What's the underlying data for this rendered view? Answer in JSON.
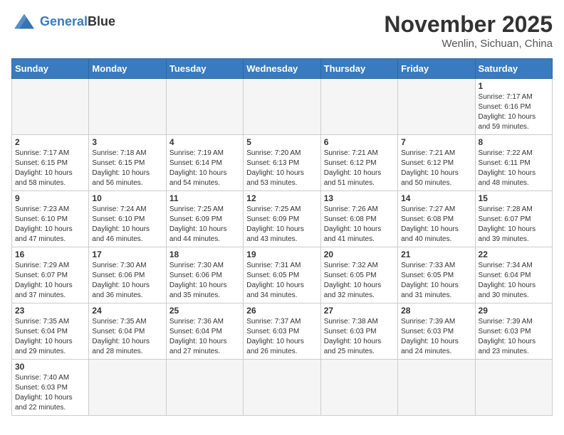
{
  "header": {
    "logo_general": "General",
    "logo_blue": "Blue",
    "month_title": "November 2025",
    "location": "Wenlin, Sichuan, China"
  },
  "weekdays": [
    "Sunday",
    "Monday",
    "Tuesday",
    "Wednesday",
    "Thursday",
    "Friday",
    "Saturday"
  ],
  "weeks": [
    [
      {
        "day": "",
        "info": ""
      },
      {
        "day": "",
        "info": ""
      },
      {
        "day": "",
        "info": ""
      },
      {
        "day": "",
        "info": ""
      },
      {
        "day": "",
        "info": ""
      },
      {
        "day": "",
        "info": ""
      },
      {
        "day": "1",
        "info": "Sunrise: 7:17 AM\nSunset: 6:16 PM\nDaylight: 10 hours and 59 minutes."
      }
    ],
    [
      {
        "day": "2",
        "info": "Sunrise: 7:17 AM\nSunset: 6:15 PM\nDaylight: 10 hours and 58 minutes."
      },
      {
        "day": "3",
        "info": "Sunrise: 7:18 AM\nSunset: 6:15 PM\nDaylight: 10 hours and 56 minutes."
      },
      {
        "day": "4",
        "info": "Sunrise: 7:19 AM\nSunset: 6:14 PM\nDaylight: 10 hours and 54 minutes."
      },
      {
        "day": "5",
        "info": "Sunrise: 7:20 AM\nSunset: 6:13 PM\nDaylight: 10 hours and 53 minutes."
      },
      {
        "day": "6",
        "info": "Sunrise: 7:21 AM\nSunset: 6:12 PM\nDaylight: 10 hours and 51 minutes."
      },
      {
        "day": "7",
        "info": "Sunrise: 7:21 AM\nSunset: 6:12 PM\nDaylight: 10 hours and 50 minutes."
      },
      {
        "day": "8",
        "info": "Sunrise: 7:22 AM\nSunset: 6:11 PM\nDaylight: 10 hours and 48 minutes."
      }
    ],
    [
      {
        "day": "9",
        "info": "Sunrise: 7:23 AM\nSunset: 6:10 PM\nDaylight: 10 hours and 47 minutes."
      },
      {
        "day": "10",
        "info": "Sunrise: 7:24 AM\nSunset: 6:10 PM\nDaylight: 10 hours and 46 minutes."
      },
      {
        "day": "11",
        "info": "Sunrise: 7:25 AM\nSunset: 6:09 PM\nDaylight: 10 hours and 44 minutes."
      },
      {
        "day": "12",
        "info": "Sunrise: 7:25 AM\nSunset: 6:09 PM\nDaylight: 10 hours and 43 minutes."
      },
      {
        "day": "13",
        "info": "Sunrise: 7:26 AM\nSunset: 6:08 PM\nDaylight: 10 hours and 41 minutes."
      },
      {
        "day": "14",
        "info": "Sunrise: 7:27 AM\nSunset: 6:08 PM\nDaylight: 10 hours and 40 minutes."
      },
      {
        "day": "15",
        "info": "Sunrise: 7:28 AM\nSunset: 6:07 PM\nDaylight: 10 hours and 39 minutes."
      }
    ],
    [
      {
        "day": "16",
        "info": "Sunrise: 7:29 AM\nSunset: 6:07 PM\nDaylight: 10 hours and 37 minutes."
      },
      {
        "day": "17",
        "info": "Sunrise: 7:30 AM\nSunset: 6:06 PM\nDaylight: 10 hours and 36 minutes."
      },
      {
        "day": "18",
        "info": "Sunrise: 7:30 AM\nSunset: 6:06 PM\nDaylight: 10 hours and 35 minutes."
      },
      {
        "day": "19",
        "info": "Sunrise: 7:31 AM\nSunset: 6:05 PM\nDaylight: 10 hours and 34 minutes."
      },
      {
        "day": "20",
        "info": "Sunrise: 7:32 AM\nSunset: 6:05 PM\nDaylight: 10 hours and 32 minutes."
      },
      {
        "day": "21",
        "info": "Sunrise: 7:33 AM\nSunset: 6:05 PM\nDaylight: 10 hours and 31 minutes."
      },
      {
        "day": "22",
        "info": "Sunrise: 7:34 AM\nSunset: 6:04 PM\nDaylight: 10 hours and 30 minutes."
      }
    ],
    [
      {
        "day": "23",
        "info": "Sunrise: 7:35 AM\nSunset: 6:04 PM\nDaylight: 10 hours and 29 minutes."
      },
      {
        "day": "24",
        "info": "Sunrise: 7:35 AM\nSunset: 6:04 PM\nDaylight: 10 hours and 28 minutes."
      },
      {
        "day": "25",
        "info": "Sunrise: 7:36 AM\nSunset: 6:04 PM\nDaylight: 10 hours and 27 minutes."
      },
      {
        "day": "26",
        "info": "Sunrise: 7:37 AM\nSunset: 6:03 PM\nDaylight: 10 hours and 26 minutes."
      },
      {
        "day": "27",
        "info": "Sunrise: 7:38 AM\nSunset: 6:03 PM\nDaylight: 10 hours and 25 minutes."
      },
      {
        "day": "28",
        "info": "Sunrise: 7:39 AM\nSunset: 6:03 PM\nDaylight: 10 hours and 24 minutes."
      },
      {
        "day": "29",
        "info": "Sunrise: 7:39 AM\nSunset: 6:03 PM\nDaylight: 10 hours and 23 minutes."
      }
    ],
    [
      {
        "day": "30",
        "info": "Sunrise: 7:40 AM\nSunset: 6:03 PM\nDaylight: 10 hours and 22 minutes."
      },
      {
        "day": "",
        "info": ""
      },
      {
        "day": "",
        "info": ""
      },
      {
        "day": "",
        "info": ""
      },
      {
        "day": "",
        "info": ""
      },
      {
        "day": "",
        "info": ""
      },
      {
        "day": "",
        "info": ""
      }
    ]
  ]
}
